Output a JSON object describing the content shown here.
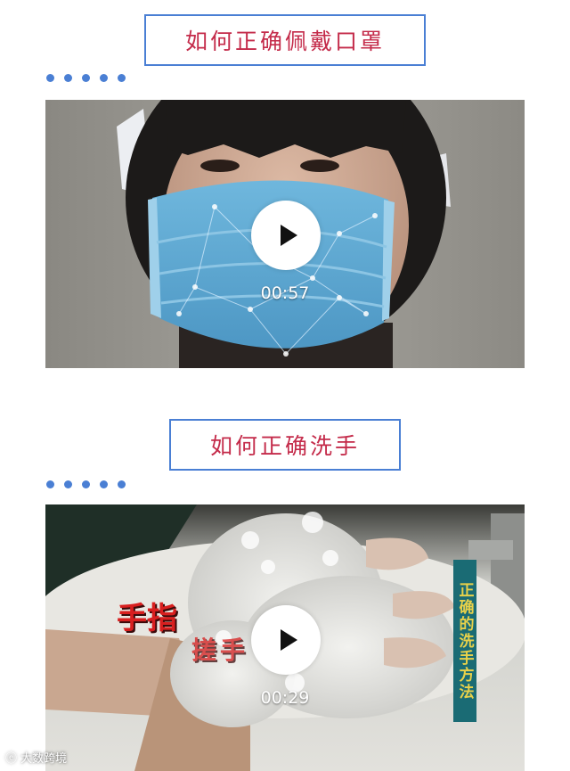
{
  "sections": [
    {
      "title": "如何正确佩戴口罩",
      "video": {
        "duration": "00:57"
      }
    },
    {
      "title": "如何正确洗手",
      "video": {
        "duration": "00:29",
        "overlay_text_1": "手指",
        "overlay_text_2": "搓手",
        "side_banner": "正确的洗手方法"
      }
    }
  ],
  "watermark": "大数跨境",
  "colors": {
    "title_text": "#c42b4a",
    "accent_blue": "#4a7fd4",
    "mask_blue": "#5aa9d6",
    "banner_teal": "#1a6b74",
    "banner_text": "#e8d14a"
  },
  "icons": [
    "play-icon",
    "dots-decoration"
  ]
}
